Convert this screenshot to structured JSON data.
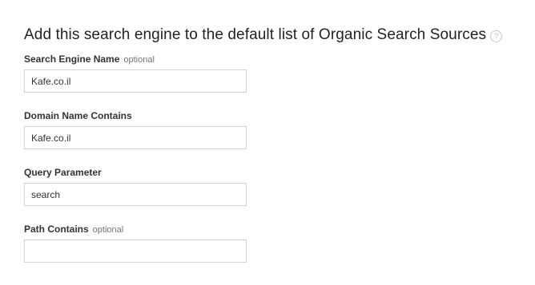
{
  "heading": {
    "title": "Add this search engine to the default list of Organic Search Sources",
    "help_icon": "?"
  },
  "fields": {
    "search_engine_name": {
      "label": "Search Engine Name",
      "optional": "optional",
      "value": "Kafe.co.il"
    },
    "domain_name_contains": {
      "label": "Domain Name Contains",
      "value": "Kafe.co.il"
    },
    "query_parameter": {
      "label": "Query Parameter",
      "value": "search"
    },
    "path_contains": {
      "label": "Path Contains",
      "optional": "optional",
      "value": ""
    }
  },
  "icons": {
    "help": "help-circle-icon"
  },
  "colors": {
    "input_border": "#d2d2d2",
    "label": "#333333",
    "optional": "#757575",
    "heading": "#222222"
  }
}
